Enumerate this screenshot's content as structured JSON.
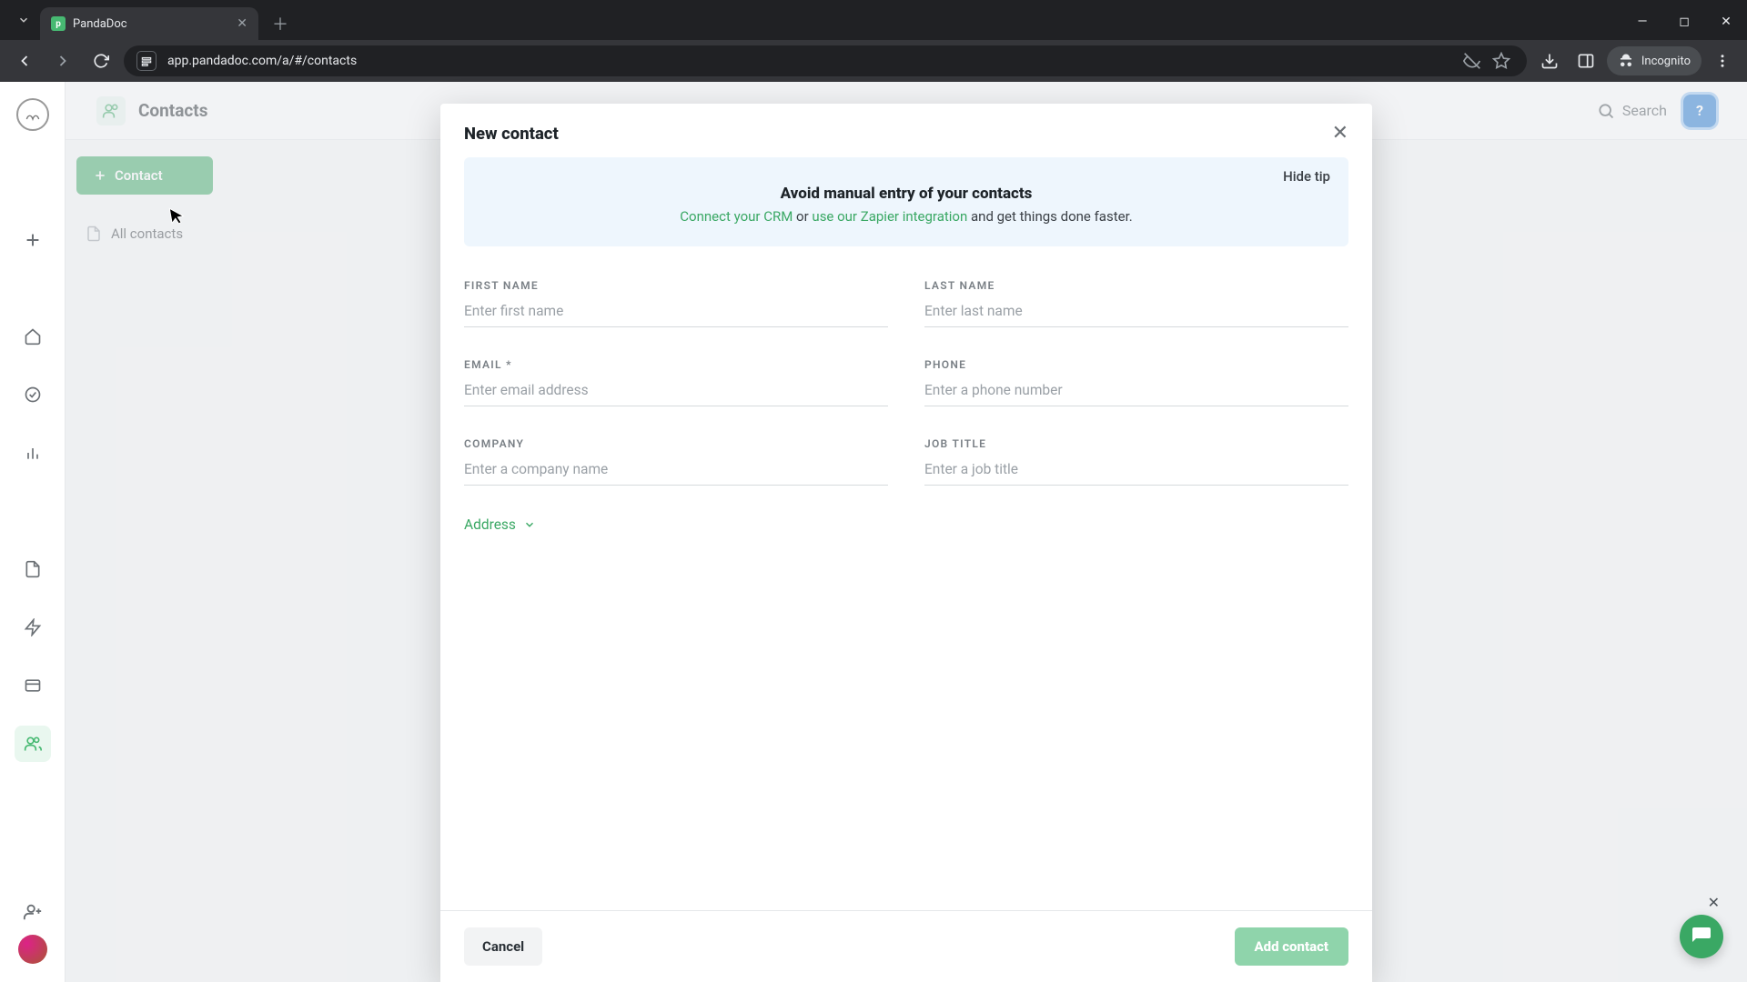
{
  "browser": {
    "tab_title": "PandaDoc",
    "url": "app.pandadoc.com/a/#/contacts",
    "incognito_label": "Incognito"
  },
  "header": {
    "title": "Contacts",
    "search_label": "Search"
  },
  "sidebar": {
    "add_button": "Contact",
    "all_contacts": "All contacts"
  },
  "modal": {
    "title": "New contact",
    "tip": {
      "hide_label": "Hide tip",
      "heading": "Avoid manual entry of your contacts",
      "crm_link": "Connect your CRM",
      "or_text": " or ",
      "zapier_link": "use our Zapier integration",
      "tail_text": " and get things done faster."
    },
    "fields": {
      "first_name": {
        "label": "FIRST NAME",
        "placeholder": "Enter first name",
        "value": ""
      },
      "last_name": {
        "label": "LAST NAME",
        "placeholder": "Enter last name",
        "value": ""
      },
      "email": {
        "label": "EMAIL *",
        "placeholder": "Enter email address",
        "value": ""
      },
      "phone": {
        "label": "PHONE",
        "placeholder": "Enter a phone number",
        "value": ""
      },
      "company": {
        "label": "COMPANY",
        "placeholder": "Enter a company name",
        "value": ""
      },
      "job_title": {
        "label": "JOB TITLE",
        "placeholder": "Enter a job title",
        "value": ""
      }
    },
    "address_toggle": "Address",
    "cancel": "Cancel",
    "submit": "Add contact"
  }
}
